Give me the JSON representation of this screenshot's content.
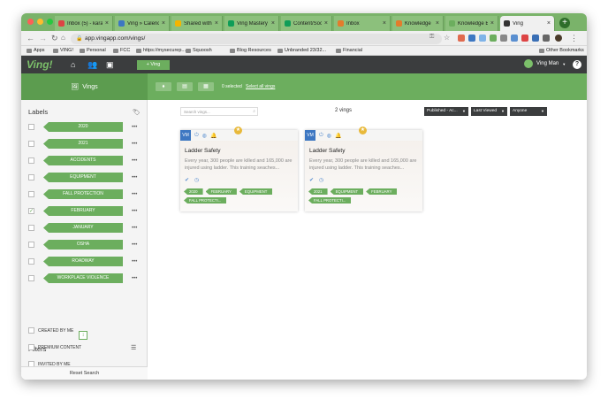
{
  "browser": {
    "tabs": [
      {
        "label": "Inbox (5) - kara@",
        "color": "#d44"
      },
      {
        "label": "Ving » Calendar",
        "color": "#3d77c2"
      },
      {
        "label": "Shared with me",
        "color": "#f4b400"
      },
      {
        "label": "Ving Mastery R",
        "color": "#0f9d58"
      },
      {
        "label": "Content/Social",
        "color": "#0f9d58"
      },
      {
        "label": "Inbox",
        "color": "#e37c2c"
      },
      {
        "label": "Knowledge",
        "color": "#e37c2c"
      },
      {
        "label": "Knowledge Base",
        "color": "#6cae5e"
      },
      {
        "label": "Ving",
        "color": "#333"
      }
    ],
    "url": "app.vingapp.com/vings/",
    "bookmarks": [
      "Apps",
      "VING!",
      "Personal",
      "FCC",
      "https://mysecurep...",
      "Squoosh",
      "Blog Resources",
      "Unbranded 23/32...",
      "Financial"
    ],
    "other_bookmarks": "Other Bookmarks"
  },
  "app": {
    "logo": "Ving!",
    "new_ving": "+ Ving",
    "user_name": "Ving Man",
    "help": "?"
  },
  "hero": {
    "title": "Vings",
    "selected_text": "0 selected",
    "select_all": "Select all vings"
  },
  "sidebar": {
    "labels_title": "Labels",
    "labels": [
      {
        "name": "2020",
        "checked": false
      },
      {
        "name": "2021",
        "checked": false
      },
      {
        "name": "ACCIDENTS",
        "checked": false
      },
      {
        "name": "EQUIPMENT",
        "checked": false
      },
      {
        "name": "FALL PROTECTION",
        "checked": false
      },
      {
        "name": "FEBRUARY",
        "checked": true
      },
      {
        "name": "JANUARY",
        "checked": false
      },
      {
        "name": "OSHA",
        "checked": false
      },
      {
        "name": "ROADWAY",
        "checked": false
      },
      {
        "name": "WORKPLACE VIOLENCE",
        "checked": false
      }
    ],
    "filters_title": "Filters",
    "filters": [
      "CREATED BY ME",
      "PREMIUM CONTENT",
      "INVITED BY ME"
    ],
    "reset": "Reset Search"
  },
  "main": {
    "search_placeholder": "Search vings...",
    "count": "2 vings",
    "dropdowns": [
      "Published - Ac...",
      "Last Viewed",
      "Anyone"
    ],
    "cards": [
      {
        "badge": "VM",
        "title": "Ladder Safety",
        "description": "Every year, 300 people are killed and 165,000 are injured using ladder. This training seaches...",
        "tags": [
          "2020",
          "FEBRUARY",
          "EQUIPMENT",
          "FALL PROTECTI..."
        ]
      },
      {
        "badge": "VM",
        "title": "Ladder Safety",
        "description": "Every year, 300 people are killed and 165,000 are injured using ladder. This training seaches...",
        "tags": [
          "2021",
          "EQUIPMENT",
          "FEBRUARY",
          "FALL PROTECTI..."
        ]
      }
    ]
  },
  "colors": {
    "brand_green": "#6cae5e",
    "nav_dark": "#3b3d3e",
    "accent_blue": "#3d77c2"
  }
}
